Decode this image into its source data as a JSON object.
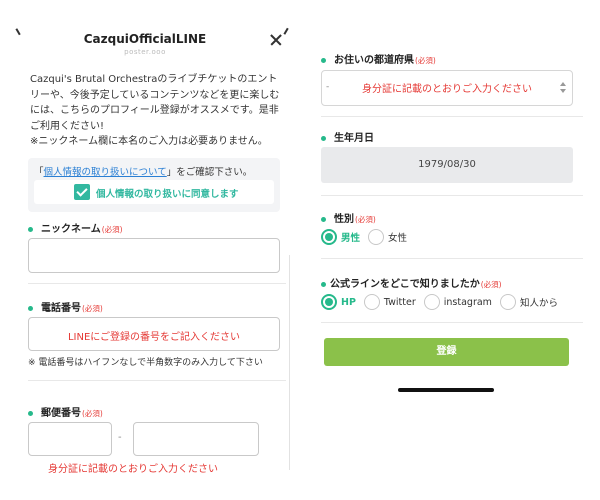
{
  "header": {
    "title": "CazquiOfficialLINE",
    "subtitle": "poster.ooo"
  },
  "intro": {
    "line1": "Cazqui's Brutal Orchestraのライブチケットのエントリーや、今後予定しているコンテンツなどを更に楽しむには、こちらのプロフィール登録がオススメです。是非ご利用ください!",
    "line2": "※ニックネーム欄に本名のご入力は必要ありません。"
  },
  "consent": {
    "prefix": "「",
    "link_text": "個人情報の取り扱いについて",
    "suffix": "」をご確認下さい。",
    "checkbox_label": "個人情報の取り扱いに同意します",
    "checked": true
  },
  "required_tag": "(必須)",
  "nickname": {
    "label": "ニックネーム"
  },
  "phone": {
    "label": "電話番号",
    "placeholder": "LINEにご登録の番号をご記入ください",
    "note": "※ 電話番号はハイフンなしで半角数字のみ入力して下さい"
  },
  "postal": {
    "label": "郵便番号",
    "separator": "-",
    "note": "身分証に記載のとおりご入力ください"
  },
  "prefecture": {
    "label": "お住いの都道府県",
    "selected": "-",
    "placeholder": "身分証に記載のとおりご入力ください"
  },
  "birthday": {
    "label": "生年月日",
    "value": "1979/08/30"
  },
  "gender": {
    "label": "性別",
    "options": [
      {
        "label": "男性",
        "selected": true
      },
      {
        "label": "女性",
        "selected": false
      }
    ]
  },
  "source": {
    "label": "公式ラインをどこで知りましたか",
    "options": [
      {
        "label": "HP",
        "selected": true
      },
      {
        "label": "Twitter",
        "selected": false
      },
      {
        "label": "instagram",
        "selected": false
      },
      {
        "label": "知人から",
        "selected": false
      }
    ]
  },
  "submit": {
    "label": "登録"
  },
  "colors": {
    "accent": "#26b98b",
    "required": "#e53935",
    "submit": "#8bc14a",
    "link": "#2a7fd4"
  }
}
